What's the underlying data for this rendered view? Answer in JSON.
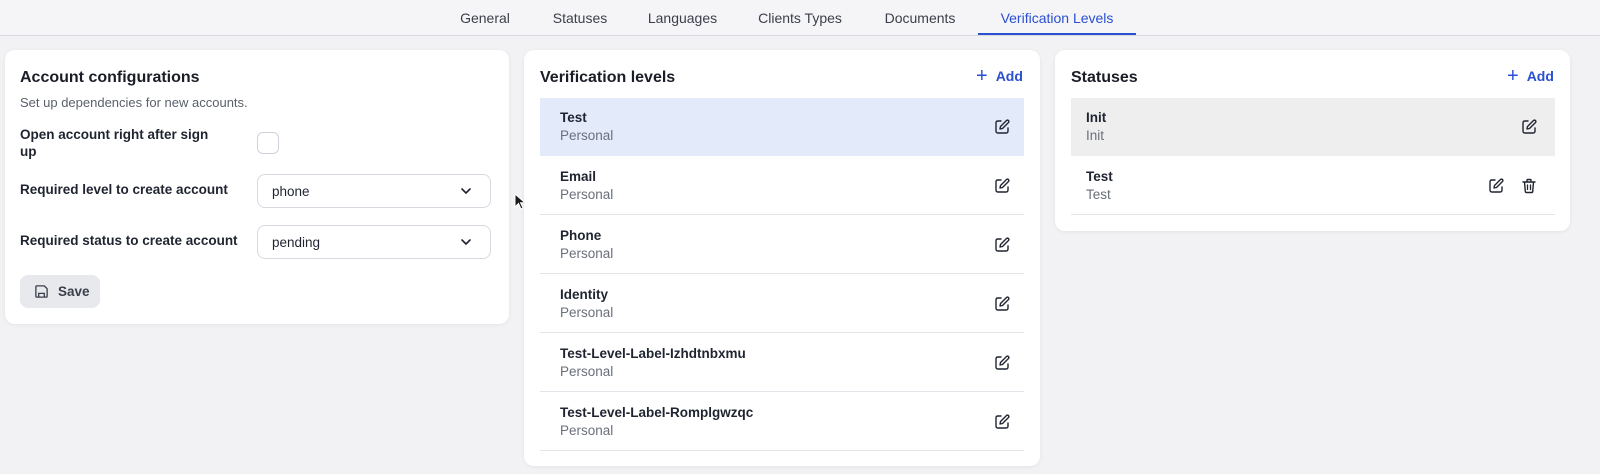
{
  "tabs": [
    {
      "label": "General"
    },
    {
      "label": "Statuses"
    },
    {
      "label": "Languages"
    },
    {
      "label": "Clients Types"
    },
    {
      "label": "Documents"
    },
    {
      "label": "Verification Levels",
      "active": true
    }
  ],
  "account": {
    "title": "Account configurations",
    "subtitle": "Set up dependencies for new accounts.",
    "open_account_label": "Open account right  after sign up",
    "open_account_label_line1": "Open account right  after sign",
    "open_account_label_line2": "up",
    "open_account_checked": false,
    "required_level_label": "Required level to create account",
    "required_level_value": "phone",
    "required_status_label": "Required status to create account",
    "required_status_value": "pending",
    "save_label": "Save"
  },
  "levels": {
    "title": "Verification levels",
    "add_label": "Add",
    "items": [
      {
        "name": "Test",
        "type": "Personal",
        "selected": true
      },
      {
        "name": "Email",
        "type": "Personal"
      },
      {
        "name": "Phone",
        "type": "Personal"
      },
      {
        "name": "Identity",
        "type": "Personal"
      },
      {
        "name": "Test-Level-Label-Izhdtnbxmu",
        "type": "Personal"
      },
      {
        "name": "Test-Level-Label-Romplgwzqc",
        "type": "Personal"
      }
    ]
  },
  "statuses": {
    "title": "Statuses",
    "add_label": "Add",
    "items": [
      {
        "name": "Init",
        "code": "Init",
        "selected": true
      },
      {
        "name": "Test",
        "code": "Test",
        "deletable": true
      }
    ]
  },
  "colors": {
    "accent": "#2a4fd0",
    "selected_level_bg": "#e3ebfb",
    "selected_status_bg": "#eeeeef"
  }
}
